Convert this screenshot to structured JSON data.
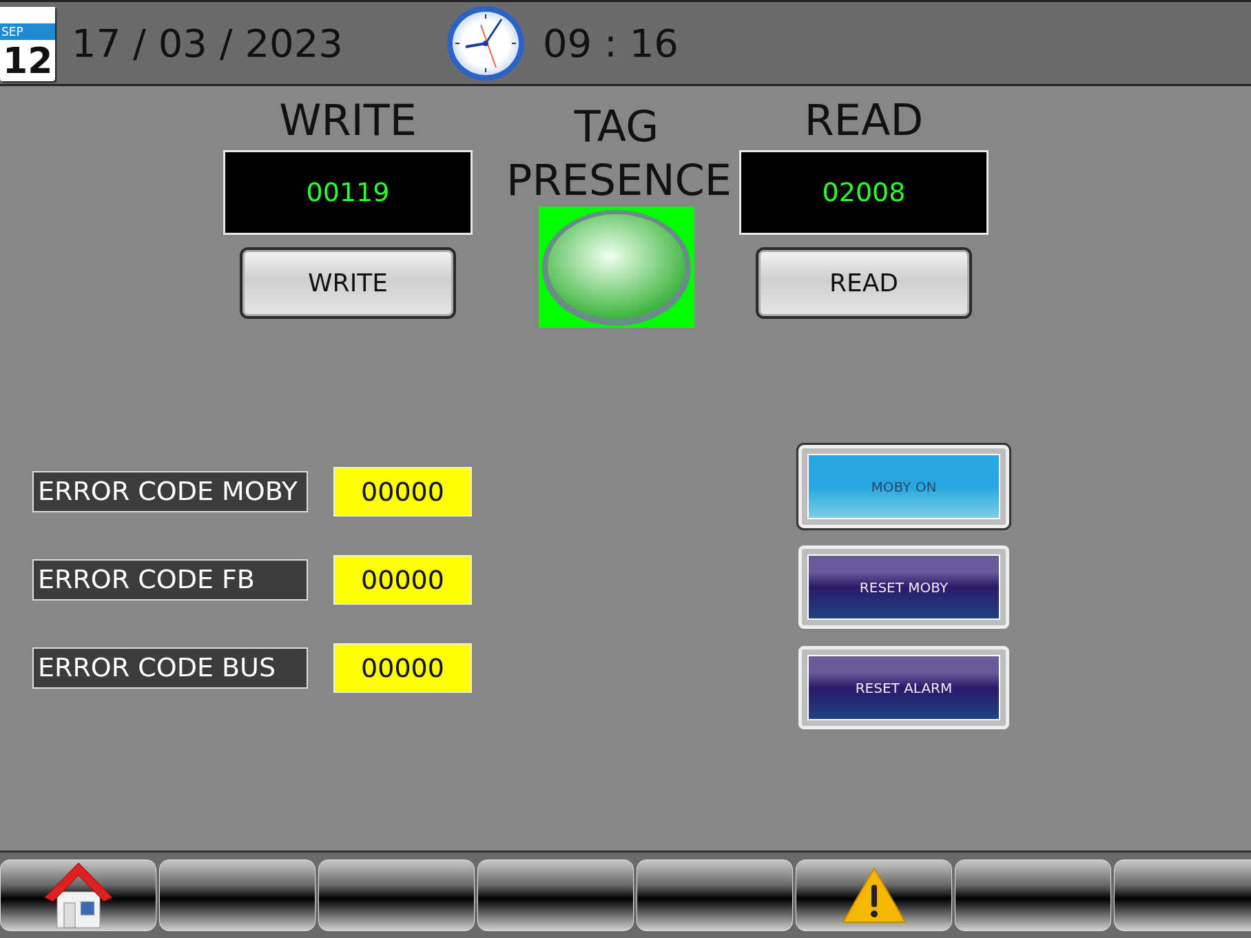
{
  "header": {
    "calendar": {
      "month": "SEP",
      "day": "12"
    },
    "date": "17 / 03 / 2023",
    "time": "09 : 16"
  },
  "write": {
    "title": "WRITE",
    "value": "00119",
    "button": "WRITE"
  },
  "tag_presence": {
    "title": "TAG PRESENCE",
    "on": true
  },
  "read": {
    "title": "READ",
    "value": "02008",
    "button": "READ"
  },
  "error_codes": [
    {
      "label": "ERROR CODE MOBY",
      "value": "00000"
    },
    {
      "label": "ERROR CODE FB",
      "value": "00000"
    },
    {
      "label": "ERROR CODE BUS",
      "value": "00000"
    }
  ],
  "actions": [
    {
      "label": "MOBY ON",
      "kind": "light"
    },
    {
      "label": "RESET MOBY",
      "kind": "dark"
    },
    {
      "label": "RESET ALARM",
      "kind": "dark"
    }
  ],
  "nav_buttons": [
    {
      "kind": "home"
    },
    {
      "kind": "blank"
    },
    {
      "kind": "blank"
    },
    {
      "kind": "blank"
    },
    {
      "kind": "blank"
    },
    {
      "kind": "alarm"
    },
    {
      "kind": "blank"
    },
    {
      "kind": "blank"
    }
  ]
}
